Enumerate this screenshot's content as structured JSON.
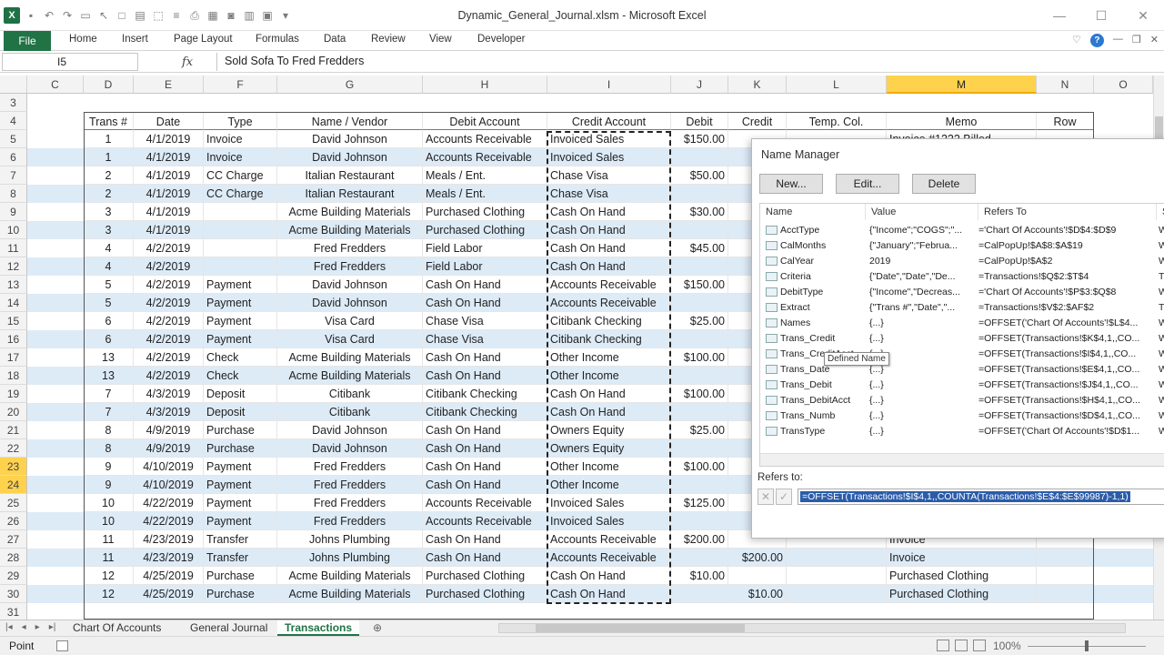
{
  "window": {
    "title": "Dynamic_General_Journal.xlsm - Microsoft Excel"
  },
  "ribbon": {
    "file": "File",
    "tabs": [
      "Home",
      "Insert",
      "Page Layout",
      "Formulas",
      "Data",
      "Review",
      "View",
      "Developer"
    ]
  },
  "formula_bar": {
    "name_box": "I5",
    "fx": "fx",
    "content": "Sold Sofa To Fred Fredders"
  },
  "columns": [
    "C",
    "D",
    "E",
    "F",
    "G",
    "H",
    "I",
    "J",
    "K",
    "L",
    "M",
    "N",
    "O"
  ],
  "row_numbers": [
    "3",
    "4",
    "5",
    "6",
    "7",
    "8",
    "9",
    "10",
    "11",
    "12",
    "13",
    "14",
    "15",
    "16",
    "17",
    "18",
    "19",
    "20",
    "21",
    "22",
    "23",
    "24",
    "25",
    "26",
    "27",
    "28",
    "29",
    "30",
    "31"
  ],
  "table": {
    "headers": [
      "Trans #",
      "Date",
      "Type",
      "Name / Vendor",
      "Debit Account",
      "Credit Account",
      "Debit",
      "Credit",
      "Temp. Col.",
      "Memo",
      "Row"
    ],
    "rows": [
      [
        "1",
        "4/1/2019",
        "Invoice",
        "David Johnson",
        "Accounts Receivable",
        "Invoiced Sales",
        "$150.00",
        "",
        "",
        "Invoice #1222 Billed",
        ""
      ],
      [
        "1",
        "4/1/2019",
        "Invoice",
        "David Johnson",
        "Accounts Receivable",
        "Invoiced Sales",
        "",
        "$1",
        "",
        "",
        ""
      ],
      [
        "2",
        "4/1/2019",
        "CC Charge",
        "Italian Restaurant",
        "Meals / Ent.",
        "Chase Visa",
        "$50.00",
        "",
        "",
        "",
        ""
      ],
      [
        "2",
        "4/1/2019",
        "CC Charge",
        "Italian Restaurant",
        "Meals / Ent.",
        "Chase Visa",
        "",
        "$",
        "",
        "",
        ""
      ],
      [
        "3",
        "4/1/2019",
        "",
        "Acme Building Materials",
        "Purchased Clothing",
        "Cash On Hand",
        "$30.00",
        "",
        "",
        "",
        ""
      ],
      [
        "3",
        "4/1/2019",
        "",
        "Acme Building Materials",
        "Purchased Clothing",
        "Cash On Hand",
        "",
        "$",
        "",
        "",
        ""
      ],
      [
        "4",
        "4/2/2019",
        "",
        "Fred Fredders",
        "Field Labor",
        "Cash On Hand",
        "$45.00",
        "",
        "",
        "",
        ""
      ],
      [
        "4",
        "4/2/2019",
        "",
        "Fred Fredders",
        "Field Labor",
        "Cash On Hand",
        "",
        "$",
        "",
        "",
        ""
      ],
      [
        "5",
        "4/2/2019",
        "Payment",
        "David Johnson",
        "Cash On Hand",
        "Accounts Receivable",
        "$150.00",
        "",
        "",
        "",
        ""
      ],
      [
        "5",
        "4/2/2019",
        "Payment",
        "David Johnson",
        "Cash On Hand",
        "Accounts Receivable",
        "",
        "$1",
        "",
        "",
        ""
      ],
      [
        "6",
        "4/2/2019",
        "Payment",
        "Visa Card",
        "Chase Visa",
        "Citibank Checking",
        "$25.00",
        "",
        "",
        "",
        ""
      ],
      [
        "6",
        "4/2/2019",
        "Payment",
        "Visa Card",
        "Chase Visa",
        "Citibank Checking",
        "",
        "$",
        "",
        "",
        ""
      ],
      [
        "13",
        "4/2/2019",
        "Check",
        "Acme Building Materials",
        "Cash On Hand",
        "Other Income",
        "$100.00",
        "",
        "",
        "",
        ""
      ],
      [
        "13",
        "4/2/2019",
        "Check",
        "Acme Building Materials",
        "Cash On Hand",
        "Other Income",
        "",
        "$1",
        "",
        "",
        ""
      ],
      [
        "7",
        "4/3/2019",
        "Deposit",
        "Citibank",
        "Citibank Checking",
        "Cash On Hand",
        "$100.00",
        "",
        "",
        "",
        ""
      ],
      [
        "7",
        "4/3/2019",
        "Deposit",
        "Citibank",
        "Citibank Checking",
        "Cash On Hand",
        "",
        "$1",
        "",
        "",
        ""
      ],
      [
        "8",
        "4/9/2019",
        "Purchase",
        "David Johnson",
        "Cash On Hand",
        "Owners Equity",
        "$25.00",
        "",
        "",
        "",
        ""
      ],
      [
        "8",
        "4/9/2019",
        "Purchase",
        "David Johnson",
        "Cash On Hand",
        "Owners Equity",
        "",
        "$",
        "",
        "",
        ""
      ],
      [
        "9",
        "4/10/2019",
        "Payment",
        "Fred Fredders",
        "Cash On Hand",
        "Other Income",
        "$100.00",
        "",
        "",
        "",
        ""
      ],
      [
        "9",
        "4/10/2019",
        "Payment",
        "Fred Fredders",
        "Cash On Hand",
        "Other Income",
        "",
        "$1",
        "",
        "",
        ""
      ],
      [
        "10",
        "4/22/2019",
        "Payment",
        "Fred Fredders",
        "Accounts Receivable",
        "Invoiced Sales",
        "$125.00",
        "",
        "",
        "",
        ""
      ],
      [
        "10",
        "4/22/2019",
        "Payment",
        "Fred Fredders",
        "Accounts Receivable",
        "Invoiced Sales",
        "",
        "$1",
        "",
        "",
        ""
      ],
      [
        "11",
        "4/23/2019",
        "Transfer",
        "Johns Plumbing",
        "Cash On Hand",
        "Accounts Receivable",
        "$200.00",
        "",
        "",
        "Invoice",
        ""
      ],
      [
        "11",
        "4/23/2019",
        "Transfer",
        "Johns Plumbing",
        "Cash On Hand",
        "Accounts Receivable",
        "",
        "$200.00",
        "",
        "Invoice",
        ""
      ],
      [
        "12",
        "4/25/2019",
        "Purchase",
        "Acme Building Materials",
        "Purchased Clothing",
        "Cash On Hand",
        "$10.00",
        "",
        "",
        "Purchased Clothing",
        ""
      ],
      [
        "12",
        "4/25/2019",
        "Purchase",
        "Acme Building Materials",
        "Purchased Clothing",
        "Cash On Hand",
        "",
        "$10.00",
        "",
        "Purchased Clothing",
        ""
      ]
    ]
  },
  "name_manager": {
    "title": "Name Manager",
    "buttons": [
      "New...",
      "Edit...",
      "Delete"
    ],
    "columns": [
      "Name",
      "Value",
      "Refers To",
      "Sc"
    ],
    "items": [
      {
        "name": "AcctType",
        "value": "{\"Income\";\"COGS\";\"...",
        "refers": "='Chart Of Accounts'!$D$4:$D$9",
        "scope": "W"
      },
      {
        "name": "CalMonths",
        "value": "{\"January\";\"Februa...",
        "refers": "=CalPopUp!$A$8:$A$19",
        "scope": "W"
      },
      {
        "name": "CalYear",
        "value": "2019",
        "refers": "=CalPopUp!$A$2",
        "scope": "W"
      },
      {
        "name": "Criteria",
        "value": "{\"Date\",\"Date\",\"De...",
        "refers": "=Transactions!$Q$2:$T$4",
        "scope": "Tr"
      },
      {
        "name": "DebitType",
        "value": "{\"Income\",\"Decreas...",
        "refers": "='Chart Of Accounts'!$P$3:$Q$8",
        "scope": "W"
      },
      {
        "name": "Extract",
        "value": "{\"Trans #\",\"Date\",\"...",
        "refers": "=Transactions!$V$2:$AF$2",
        "scope": "Tr"
      },
      {
        "name": "Names",
        "value": "{...}",
        "refers": "=OFFSET('Chart Of Accounts'!$L$4...",
        "scope": "W"
      },
      {
        "name": "Trans_Credit",
        "value": "{...}",
        "refers": "=OFFSET(Transactions!$K$4,1,,CO...",
        "scope": "W"
      },
      {
        "name": "Trans_CreditAcct",
        "value": "{...}",
        "refers": "=OFFSET(Transactions!$I$4,1,,CO...",
        "scope": "W"
      },
      {
        "name": "Trans_Date",
        "value": "{...}",
        "refers": "=OFFSET(Transactions!$E$4,1,,CO...",
        "scope": "W"
      },
      {
        "name": "Trans_Debit",
        "value": "{...}",
        "refers": "=OFFSET(Transactions!$J$4,1,,CO...",
        "scope": "W"
      },
      {
        "name": "Trans_DebitAcct",
        "value": "{...}",
        "refers": "=OFFSET(Transactions!$H$4,1,,CO...",
        "scope": "W"
      },
      {
        "name": "Trans_Numb",
        "value": "{...}",
        "refers": "=OFFSET(Transactions!$D$4,1,,CO...",
        "scope": "W"
      },
      {
        "name": "TransType",
        "value": "{...}",
        "refers": "=OFFSET('Chart Of Accounts'!$D$1...",
        "scope": "W"
      }
    ],
    "refers_to_label": "Refers to:",
    "refers_to_value": "=OFFSET(Transactions!$I$4,1,,COUNTA(Transactions!$E$4:$E$99987)-1,1)",
    "tooltip": "Defined Name"
  },
  "sheets": {
    "tabs": [
      "Chart Of Accounts",
      "General Journal",
      "Transactions"
    ],
    "active": "Transactions"
  },
  "status": {
    "mode": "Point",
    "zoom": "100%"
  }
}
